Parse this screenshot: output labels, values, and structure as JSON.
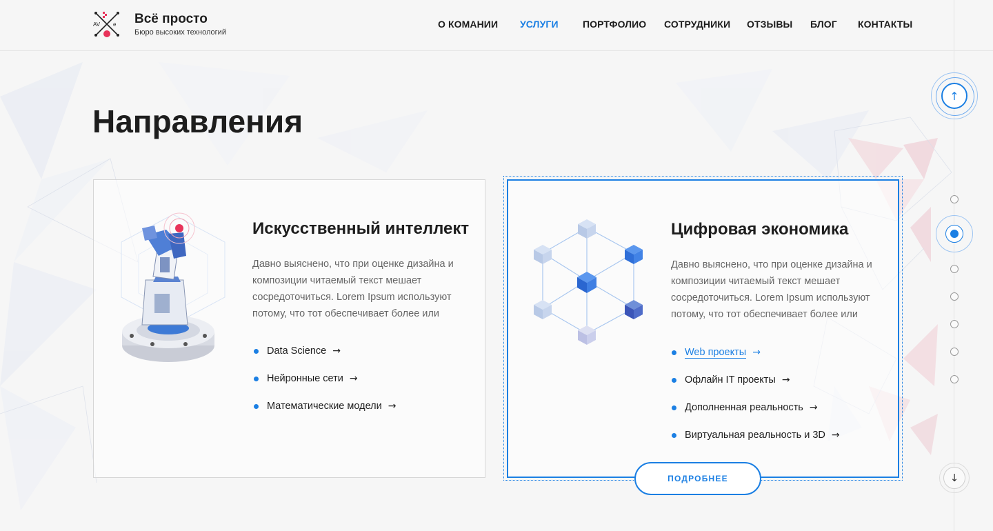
{
  "brand": {
    "title": "Всё просто",
    "subtitle": "Бюро высоких технологий",
    "logo_icon": "compass-cross-logo-icon",
    "logo_text": "AV e"
  },
  "nav": {
    "items": [
      {
        "label": "О КОМАНИИ",
        "active": false
      },
      {
        "label": "УСЛУГИ",
        "active": true
      },
      {
        "label": "ПОРТФОЛИО",
        "active": false
      },
      {
        "label": "СОТРУДНИКИ",
        "active": false
      },
      {
        "label": "ОТЗЫВЫ",
        "active": false
      },
      {
        "label": "БЛОГ",
        "active": false
      },
      {
        "label": "КОНТАКТЫ",
        "active": false
      }
    ]
  },
  "pager": {
    "up_icon": "arrow-up-icon",
    "up_glyph": "↑",
    "down_icon": "arrow-down-icon",
    "down_glyph": "↓",
    "dots_total": 8,
    "active_index": 1
  },
  "page": {
    "title": "Направления"
  },
  "cards": [
    {
      "title": "Искусственный интеллект",
      "text": "Давно выяснено, что при оценке дизайна и композиции читаемый текст мешает сосредоточиться. Lorem Ipsum используют потому, что тот обеспечивает более или",
      "illustration": "robot-arm-illustration",
      "items": [
        {
          "label": "Data Science",
          "arrow": "→"
        },
        {
          "label": "Нейронные сети",
          "arrow": "→"
        },
        {
          "label": "Математические модели",
          "arrow": "→"
        }
      ]
    },
    {
      "title": "Цифровая экономика",
      "text": "Давно выяснено, что при оценке дизайна и композиции читаемый текст мешает сосредоточиться. Lorem Ipsum используют потому, что тот обеспечивает более или",
      "illustration": "cube-network-illustration",
      "items": [
        {
          "label": "Web проекты",
          "arrow": "→",
          "hovered": true
        },
        {
          "label": "Офлайн IT проекты",
          "arrow": "→"
        },
        {
          "label": "Дополненная реальность",
          "arrow": "→"
        },
        {
          "label": "Виртуальная реальность и 3D",
          "arrow": "→"
        }
      ],
      "button": "ПОДРОБНЕЕ"
    }
  ],
  "colors": {
    "accent": "#1b7fe3",
    "text": "#1d1d1d",
    "muted": "#666666",
    "border": "#d6d6d6",
    "robot_accent": "#e8335a"
  }
}
